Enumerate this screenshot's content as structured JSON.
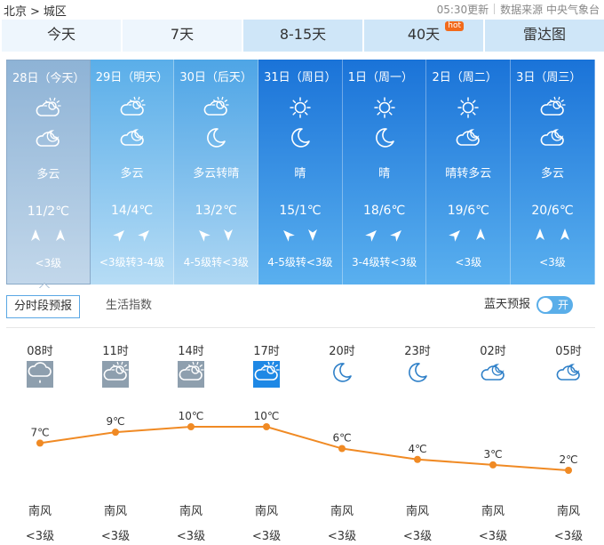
{
  "header": {
    "breadcrumb": [
      "北京",
      ">",
      "城区"
    ],
    "updated": "05:30更新",
    "source": "数据来源 中央气象台"
  },
  "tabs": [
    {
      "label": "今天",
      "active": true
    },
    {
      "label": "7天",
      "active": true
    },
    {
      "label": "8-15天"
    },
    {
      "label": "40天",
      "badge": "hot"
    },
    {
      "label": "雷达图"
    }
  ],
  "days": [
    {
      "date": "28日（今天）",
      "icon_day": "partly-cloudy-icon",
      "icon_night": "cloudy-night-icon",
      "desc": "多云",
      "temp": "11/2℃",
      "wind_dirs": [
        "N",
        "N"
      ],
      "wind": "<3级"
    },
    {
      "date": "29日（明天）",
      "icon_day": "partly-cloudy-icon",
      "icon_night": "cloudy-night-icon",
      "desc": "多云",
      "temp": "14/4℃",
      "wind_dirs": [
        "NE",
        "NE"
      ],
      "wind": "<3级转3-4级"
    },
    {
      "date": "30日（后天）",
      "icon_day": "partly-cloudy-icon",
      "icon_night": "moon-icon",
      "desc": "多云转晴",
      "temp": "13/2℃",
      "wind_dirs": [
        "NW",
        "S"
      ],
      "wind": "4-5级转<3级"
    },
    {
      "date": "31日（周日）",
      "icon_day": "sun-icon",
      "icon_night": "moon-icon",
      "desc": "晴",
      "temp": "15/1℃",
      "wind_dirs": [
        "NW",
        "S"
      ],
      "wind": "4-5级转<3级"
    },
    {
      "date": "1日（周一）",
      "icon_day": "sun-icon",
      "icon_night": "moon-icon",
      "desc": "晴",
      "temp": "18/6℃",
      "wind_dirs": [
        "NE",
        "NE"
      ],
      "wind": "3-4级转<3级"
    },
    {
      "date": "2日（周二）",
      "icon_day": "sun-icon",
      "icon_night": "cloudy-night-icon",
      "desc": "晴转多云",
      "temp": "19/6℃",
      "wind_dirs": [
        "NE",
        "N"
      ],
      "wind": "<3级"
    },
    {
      "date": "3日（周三）",
      "icon_day": "partly-cloudy-icon",
      "icon_night": "cloudy-night-icon",
      "desc": "多云",
      "temp": "20/6℃",
      "wind_dirs": [
        "N",
        "N"
      ],
      "wind": "<3级"
    }
  ],
  "subnav": {
    "active": "分时段预报",
    "other": "生活指数",
    "blue_sky_label": "蓝天预报",
    "toggle_label": "开"
  },
  "hourly": [
    {
      "time": "08时",
      "icon": "rain-cloud-icon",
      "temp": 7,
      "temp_label": "7℃",
      "wind_dir": "南风",
      "wind_level": "<3级"
    },
    {
      "time": "11时",
      "icon": "partly-cloudy-icon",
      "temp": 9,
      "temp_label": "9℃",
      "wind_dir": "南风",
      "wind_level": "<3级"
    },
    {
      "time": "14时",
      "icon": "partly-cloudy-icon",
      "temp": 10,
      "temp_label": "10℃",
      "wind_dir": "南风",
      "wind_level": "<3级"
    },
    {
      "time": "17时",
      "icon": "partly-cloudy-icon",
      "temp": 10,
      "temp_label": "10℃",
      "wind_dir": "南风",
      "wind_level": "<3级"
    },
    {
      "time": "20时",
      "icon": "moon-icon",
      "temp": 6,
      "temp_label": "6℃",
      "wind_dir": "南风",
      "wind_level": "<3级"
    },
    {
      "time": "23时",
      "icon": "moon-icon",
      "temp": 4,
      "temp_label": "4℃",
      "wind_dir": "南风",
      "wind_level": "<3级"
    },
    {
      "time": "02时",
      "icon": "cloudy-night-icon",
      "temp": 3,
      "temp_label": "3℃",
      "wind_dir": "南风",
      "wind_level": "<3级"
    },
    {
      "time": "05时",
      "icon": "cloudy-night-icon",
      "temp": 2,
      "temp_label": "2℃",
      "wind_dir": "南风",
      "wind_level": "<3级"
    }
  ],
  "colors": {
    "line": "#f08a24",
    "accent": "#5aaee9"
  }
}
